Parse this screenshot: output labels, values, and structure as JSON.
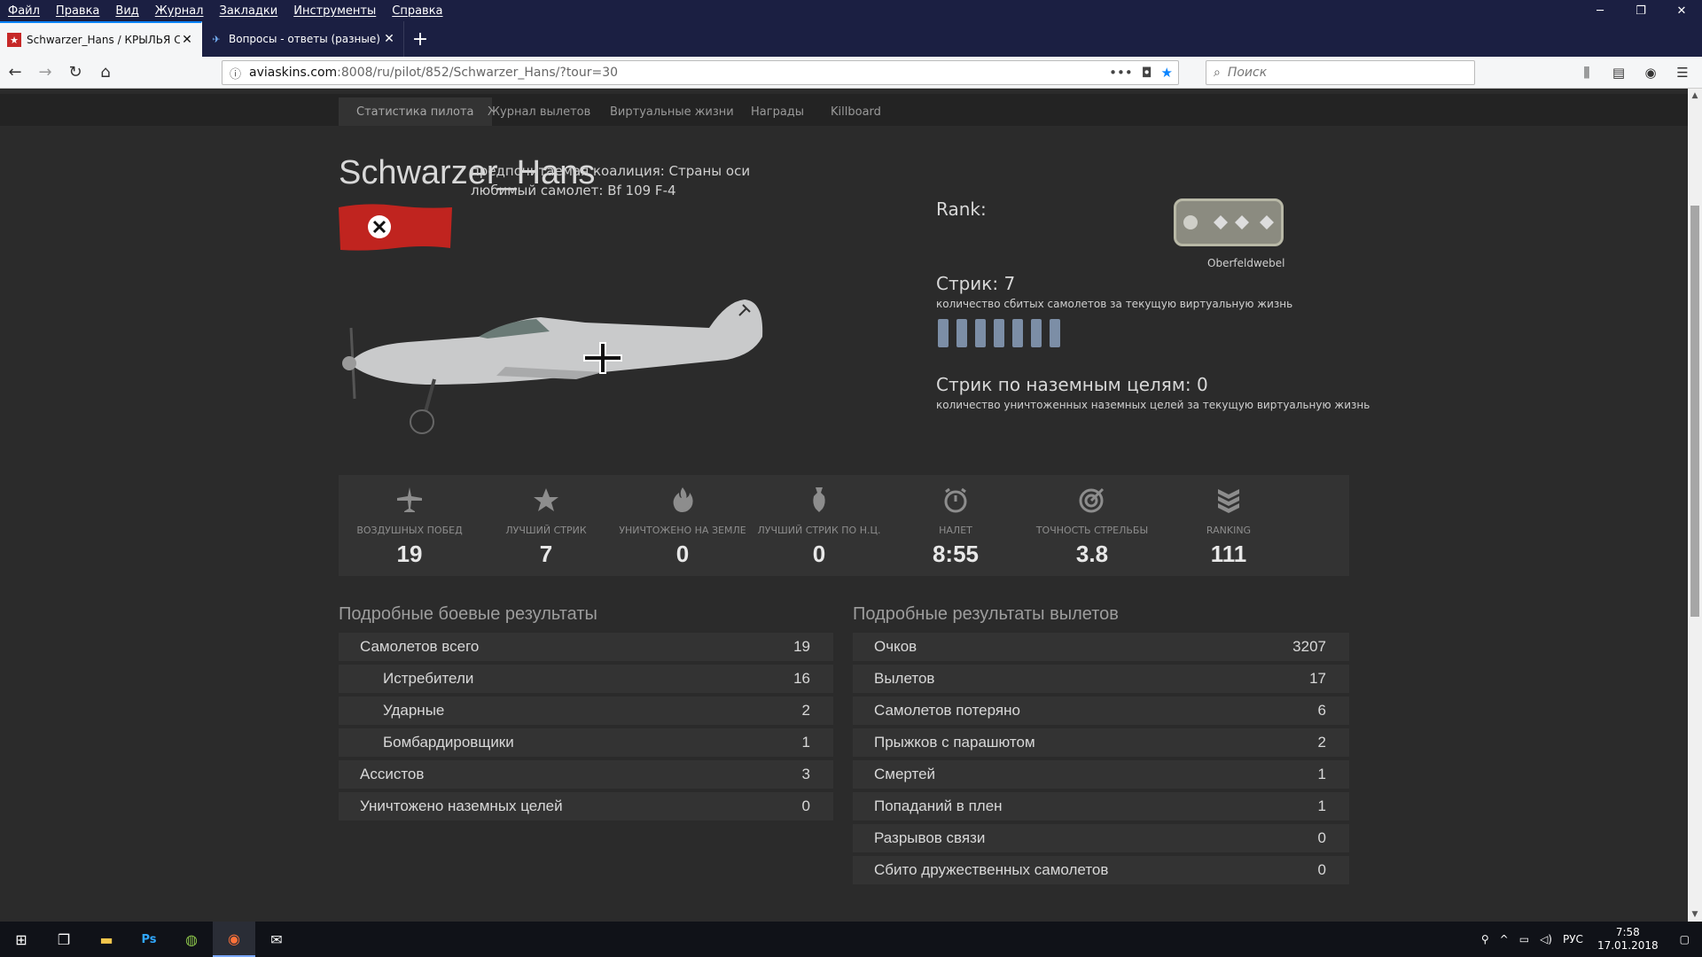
{
  "menu": [
    "Файл",
    "Правка",
    "Вид",
    "Журнал",
    "Закладки",
    "Инструменты",
    "Справка"
  ],
  "tabs": [
    {
      "title": "Schwarzer_Hans / КРЫЛЬЯ СВО"
    },
    {
      "title": "Вопросы - ответы (разные) - С"
    }
  ],
  "url": {
    "domain": "aviaskins.com",
    "path": ":8008/ru/pilot/852/Schwarzer_Hans/?tour=30"
  },
  "search": {
    "placeholder": "Поиск"
  },
  "subnav": [
    "Статистика пилота",
    "Журнал вылетов",
    "Виртуальные жизни",
    "Награды",
    "Killboard"
  ],
  "pilot": {
    "name": "Schwarzer_Hans",
    "coalition": "предпочитаемая коалиция: Страны оси",
    "favorite": "любимый самолет: Bf 109 F-4"
  },
  "rank": {
    "label": "Rank:",
    "name": "Oberfeldwebel"
  },
  "streak": {
    "title": "Стрик: 7",
    "sub": "количество сбитых самолетов за текущую виртуальную жизнь",
    "count": 7
  },
  "ground_streak": {
    "title": "Стрик по наземным целям: 0",
    "sub": "количество уничтоженных наземных целей за текущую виртуальную жизнь"
  },
  "stats": [
    {
      "label": "воздушных побед",
      "value": "19",
      "icon": "plane-icon"
    },
    {
      "label": "лучший стрик",
      "value": "7",
      "icon": "star-icon"
    },
    {
      "label": "уничтожено на земле",
      "value": "0",
      "icon": "fire-icon"
    },
    {
      "label": "лучший стрик по н.ц.",
      "value": "0",
      "icon": "bomb-icon"
    },
    {
      "label": "налет",
      "value": "8:55",
      "icon": "stopwatch-icon"
    },
    {
      "label": "точность стрельбы",
      "value": "3.8",
      "icon": "target-icon"
    },
    {
      "label": "ranking",
      "value": "111",
      "icon": "ranking-icon"
    }
  ],
  "combat": {
    "title": "Подробные боевые результаты",
    "rows": [
      {
        "k": "Самолетов всего",
        "v": "19",
        "sub": false
      },
      {
        "k": "Истребители",
        "v": "16",
        "sub": true
      },
      {
        "k": "Ударные",
        "v": "2",
        "sub": true
      },
      {
        "k": "Бомбардировщики",
        "v": "1",
        "sub": true
      },
      {
        "k": "Ассистов",
        "v": "3",
        "sub": false
      },
      {
        "k": "Уничтожено наземных целей",
        "v": "0",
        "sub": false
      }
    ]
  },
  "sorties": {
    "title": "Подробные результаты вылетов",
    "rows": [
      {
        "k": "Очков",
        "v": "3207"
      },
      {
        "k": "Вылетов",
        "v": "17"
      },
      {
        "k": "Самолетов потеряно",
        "v": "6"
      },
      {
        "k": "Прыжков с парашютом",
        "v": "2"
      },
      {
        "k": "Смертей",
        "v": "1"
      },
      {
        "k": "Попаданий в плен",
        "v": "1"
      },
      {
        "k": "Разрывов связи",
        "v": "0"
      },
      {
        "k": "Сбито дружественных самолетов",
        "v": "0"
      }
    ]
  },
  "tray": {
    "lang": "РУС",
    "time": "7:58",
    "date": "17.01.2018"
  }
}
